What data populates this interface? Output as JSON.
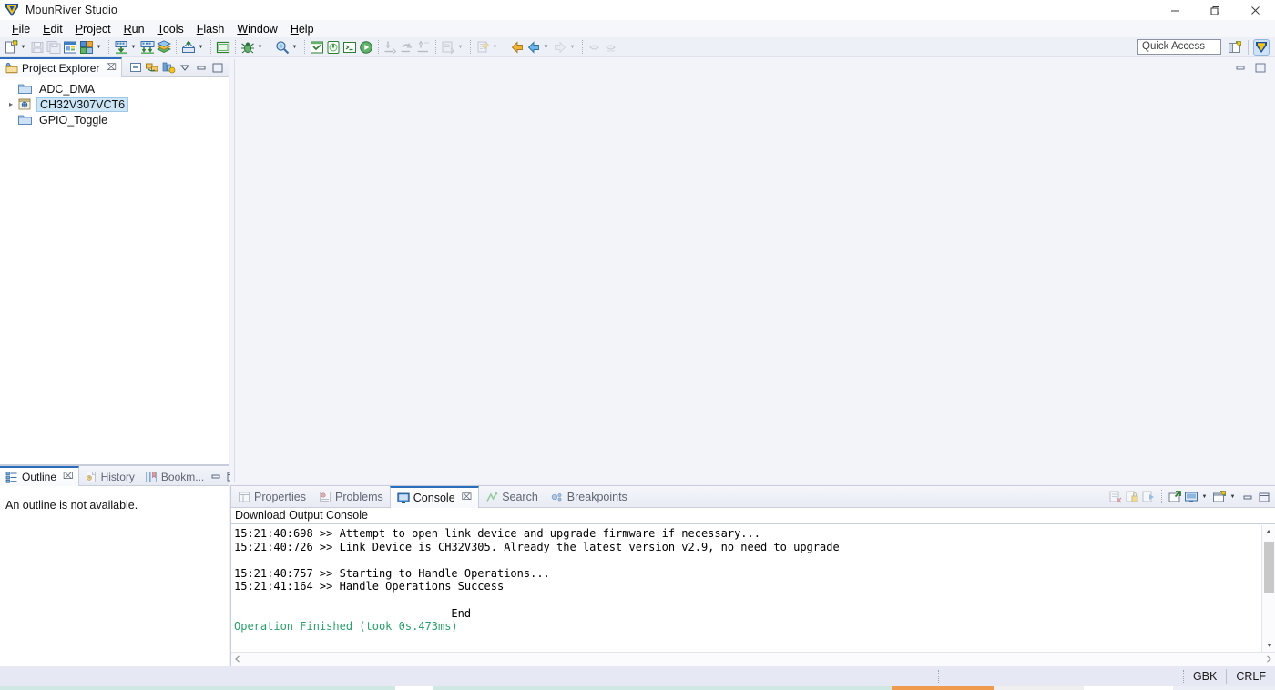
{
  "window": {
    "title": "MounRiver Studio",
    "logo_icon": "mounriver-logo-icon",
    "minimize_label": "—",
    "maximize_label": "❐",
    "close_label": "✕"
  },
  "menubar": {
    "items": [
      {
        "label": "File",
        "mnemonic": "F"
      },
      {
        "label": "Edit",
        "mnemonic": "E"
      },
      {
        "label": "Project",
        "mnemonic": "P"
      },
      {
        "label": "Run",
        "mnemonic": "R"
      },
      {
        "label": "Tools",
        "mnemonic": "T"
      },
      {
        "label": "Flash",
        "mnemonic": "F"
      },
      {
        "label": "Window",
        "mnemonic": "W"
      },
      {
        "label": "Help",
        "mnemonic": "H"
      }
    ]
  },
  "toolbar": {
    "groups": [
      {
        "items": [
          {
            "icon": "new-file-icon",
            "dropdown": true,
            "enabled": true
          },
          {
            "icon": "save-icon",
            "dropdown": false,
            "enabled": false
          },
          {
            "icon": "save-all-icon",
            "dropdown": false,
            "enabled": false
          },
          {
            "icon": "new-project-icon",
            "dropdown": false,
            "enabled": true
          },
          {
            "icon": "build-configs-icon",
            "dropdown": true,
            "enabled": true
          }
        ]
      },
      {
        "items": [
          {
            "icon": "download-icon",
            "dropdown": true,
            "enabled": true
          },
          {
            "icon": "download-all-icon",
            "dropdown": false,
            "enabled": true
          },
          {
            "icon": "build-icon",
            "dropdown": false,
            "enabled": true
          }
        ]
      },
      {
        "items": [
          {
            "icon": "flash-upload-icon",
            "dropdown": true,
            "enabled": true
          }
        ]
      },
      {
        "items": [
          {
            "icon": "terminal-window-icon",
            "dropdown": false,
            "enabled": true
          }
        ]
      },
      {
        "items": [
          {
            "icon": "debug-icon",
            "dropdown": true,
            "enabled": true
          }
        ]
      },
      {
        "items": [
          {
            "icon": "search-icon",
            "dropdown": true,
            "enabled": true
          }
        ]
      },
      {
        "items": [
          {
            "icon": "serial-monitor-icon",
            "dropdown": false,
            "enabled": true
          },
          {
            "icon": "power-tool-icon",
            "dropdown": false,
            "enabled": true
          },
          {
            "icon": "console-tool-icon",
            "dropdown": false,
            "enabled": true
          },
          {
            "icon": "run-icon",
            "dropdown": false,
            "enabled": true
          }
        ]
      },
      {
        "items": [
          {
            "icon": "step-into-icon",
            "dropdown": false,
            "enabled": false
          },
          {
            "icon": "step-over-icon",
            "dropdown": false,
            "enabled": false
          },
          {
            "icon": "step-return-icon",
            "dropdown": false,
            "enabled": false
          }
        ]
      },
      {
        "items": [
          {
            "icon": "next-annotation-icon",
            "dropdown": true,
            "enabled": false
          }
        ]
      },
      {
        "items": [
          {
            "icon": "last-edit-icon",
            "dropdown": true,
            "enabled": false
          }
        ]
      },
      {
        "items": [
          {
            "icon": "back-gold-icon",
            "dropdown": false,
            "enabled": true
          },
          {
            "icon": "back-blue-icon",
            "dropdown": true,
            "enabled": true
          },
          {
            "icon": "forward-icon",
            "dropdown": true,
            "enabled": false
          }
        ]
      },
      {
        "items": [
          {
            "icon": "pin-editor-icon",
            "dropdown": false,
            "enabled": false
          },
          {
            "icon": "pin-editor-alt-icon",
            "dropdown": false,
            "enabled": false
          }
        ]
      }
    ],
    "quick_access_placeholder": "Quick Access",
    "perspective_icons": [
      {
        "icon": "open-perspective-icon"
      },
      {
        "icon": "mounriver-perspective-icon",
        "active": true
      }
    ]
  },
  "project_explorer": {
    "tab_label": "Project Explorer",
    "tab_icon": "project-explorer-icon",
    "tab_close": "⌧",
    "tools": [
      {
        "icon": "collapse-all-icon"
      },
      {
        "icon": "link-with-editor-icon"
      },
      {
        "icon": "view-menu-filter-icon"
      },
      {
        "icon": "view-menu-icon"
      },
      {
        "icon": "minimize-icon"
      },
      {
        "icon": "maximize-icon"
      }
    ],
    "tree": [
      {
        "label": "ADC_DMA",
        "icon": "folder-icon",
        "expandable": false,
        "selected": false,
        "indent": 1
      },
      {
        "label": "CH32V307VCT6",
        "icon": "project-icon",
        "expandable": true,
        "selected": true,
        "indent": 0
      },
      {
        "label": "GPIO_Toggle",
        "icon": "folder-icon",
        "expandable": false,
        "selected": false,
        "indent": 1
      }
    ]
  },
  "outline_panel": {
    "tabs": [
      {
        "label": "Outline",
        "icon": "outline-icon",
        "active": true,
        "close": "⌧"
      },
      {
        "label": "History",
        "icon": "history-icon",
        "active": false
      },
      {
        "label": "Bookm...",
        "icon": "bookmarks-icon",
        "active": false
      }
    ],
    "tools": [
      {
        "icon": "minimize-icon"
      },
      {
        "icon": "maximize-icon"
      }
    ],
    "empty_message": "An outline is not available."
  },
  "editor_area": {
    "tools": [
      {
        "icon": "minimize-icon"
      },
      {
        "icon": "maximize-icon"
      }
    ]
  },
  "console_panel": {
    "tabs": [
      {
        "label": "Properties",
        "icon": "properties-icon",
        "active": false
      },
      {
        "label": "Problems",
        "icon": "problems-icon",
        "active": false
      },
      {
        "label": "Console",
        "icon": "console-icon",
        "active": true,
        "close": "⌧"
      },
      {
        "label": "Search",
        "icon": "search-view-icon",
        "active": false
      },
      {
        "label": "Breakpoints",
        "icon": "breakpoints-icon",
        "active": false
      }
    ],
    "tools": [
      {
        "icon": "clear-console-icon",
        "enabled": false
      },
      {
        "icon": "scroll-lock-icon",
        "enabled": false
      },
      {
        "icon": "show-console-icon",
        "enabled": false
      },
      {
        "icon": "pin-console-icon",
        "enabled": true
      },
      {
        "icon": "display-console-icon",
        "enabled": true,
        "dropdown": true
      },
      {
        "icon": "open-console-icon",
        "enabled": true,
        "dropdown": true
      },
      {
        "icon": "minimize-icon",
        "enabled": true
      },
      {
        "icon": "maximize-icon",
        "enabled": true
      }
    ],
    "title": "Download Output Console",
    "lines": [
      {
        "text": "15:21:40:698 >> Attempt to open link device and upgrade firmware if necessary...",
        "style": "normal"
      },
      {
        "text": "15:21:40:726 >> Link Device is CH32V305. Already the latest version v2.9, no need to upgrade",
        "style": "normal"
      },
      {
        "text": "",
        "style": "normal"
      },
      {
        "text": "15:21:40:757 >> Starting to Handle Operations...",
        "style": "normal"
      },
      {
        "text": "15:21:41:164 >> Handle Operations Success",
        "style": "normal"
      },
      {
        "text": "",
        "style": "normal"
      },
      {
        "text": "---------------------------------End --------------------------------",
        "style": "normal"
      },
      {
        "text": "Operation Finished (took 0s.473ms)",
        "style": "ok"
      }
    ],
    "success_color": "#2c9e6b",
    "vscroll": {
      "up": "▲",
      "down": "▼"
    },
    "hscroll": {
      "left": "‹",
      "right": "›"
    }
  },
  "statusbar": {
    "encoding": "GBK",
    "line_ending": "CRLF"
  }
}
